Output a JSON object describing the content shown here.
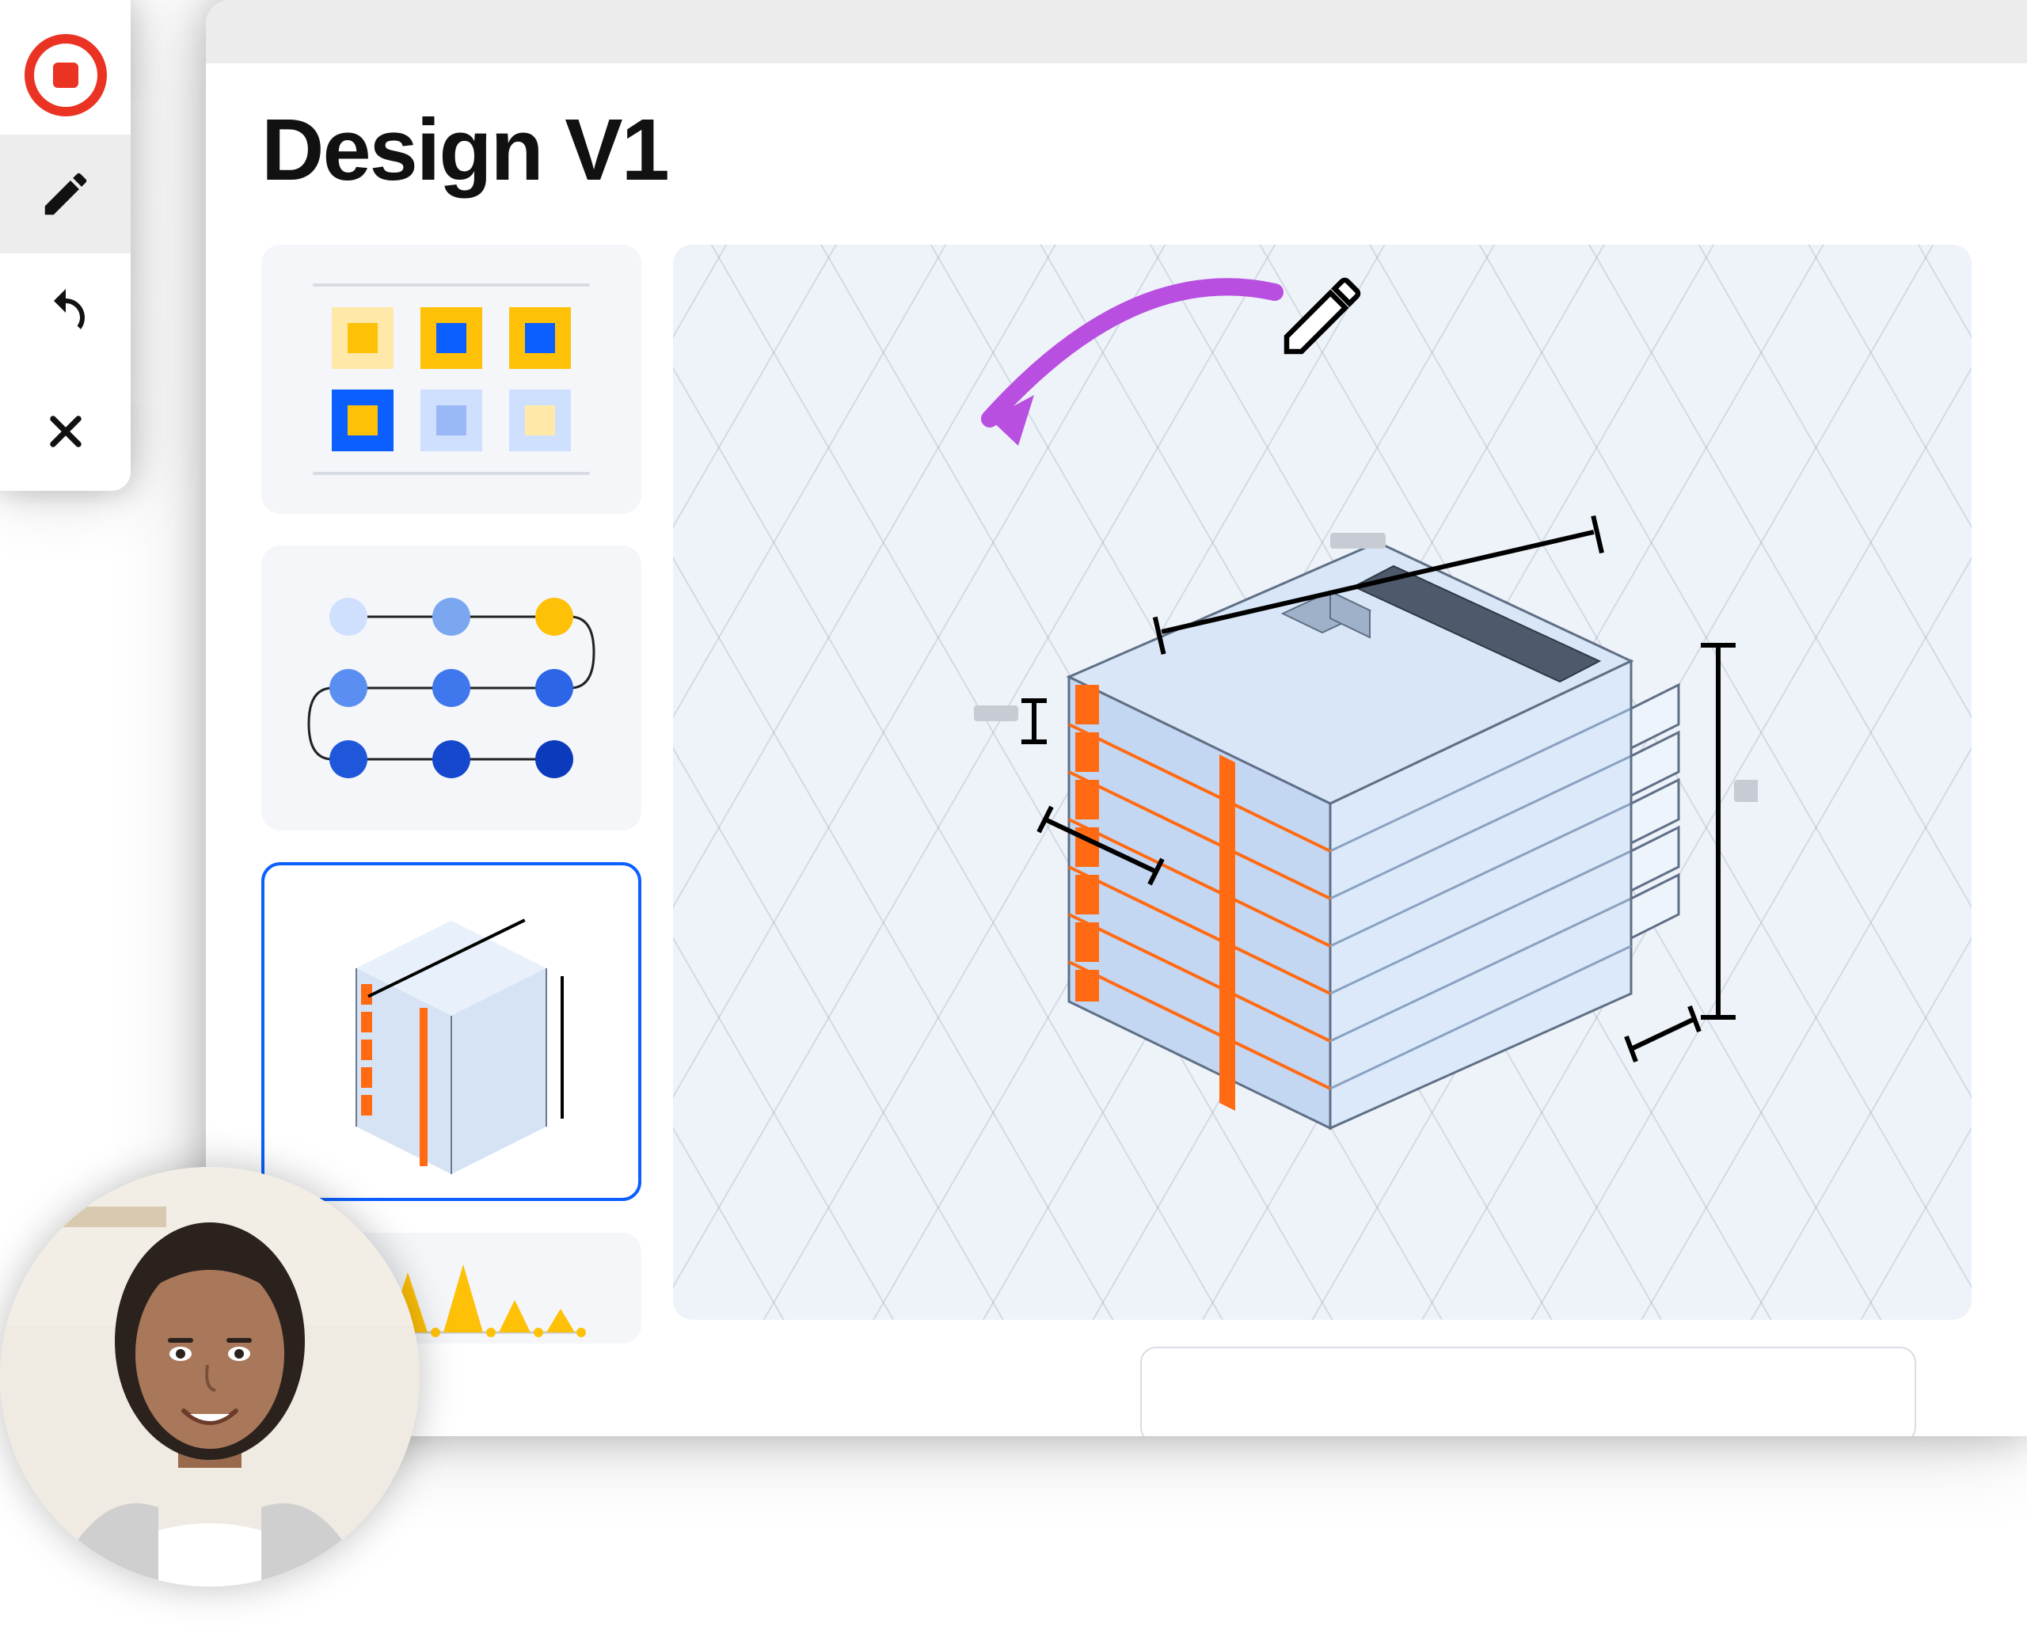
{
  "toolbar": {
    "record": "record",
    "edit": "edit",
    "redo": "redo",
    "close": "close"
  },
  "window": {
    "title": "Design V1"
  },
  "thumbnails": {
    "swatches": "color-swatches",
    "flow": "node-flow",
    "building": "building-3d",
    "chart": "bar-chart"
  },
  "colors": {
    "accent_blue": "#0b5fff",
    "accent_orange": "#ff6a13",
    "accent_yellow": "#ffc107",
    "highlight_purple": "#b84fe0",
    "record_red": "#ea3323"
  },
  "canvas": {
    "label": "3D Building Model",
    "annotation_arrow": "annotation-arrow"
  },
  "avatar": {
    "label": "presenter"
  },
  "input": {
    "placeholder": ""
  }
}
